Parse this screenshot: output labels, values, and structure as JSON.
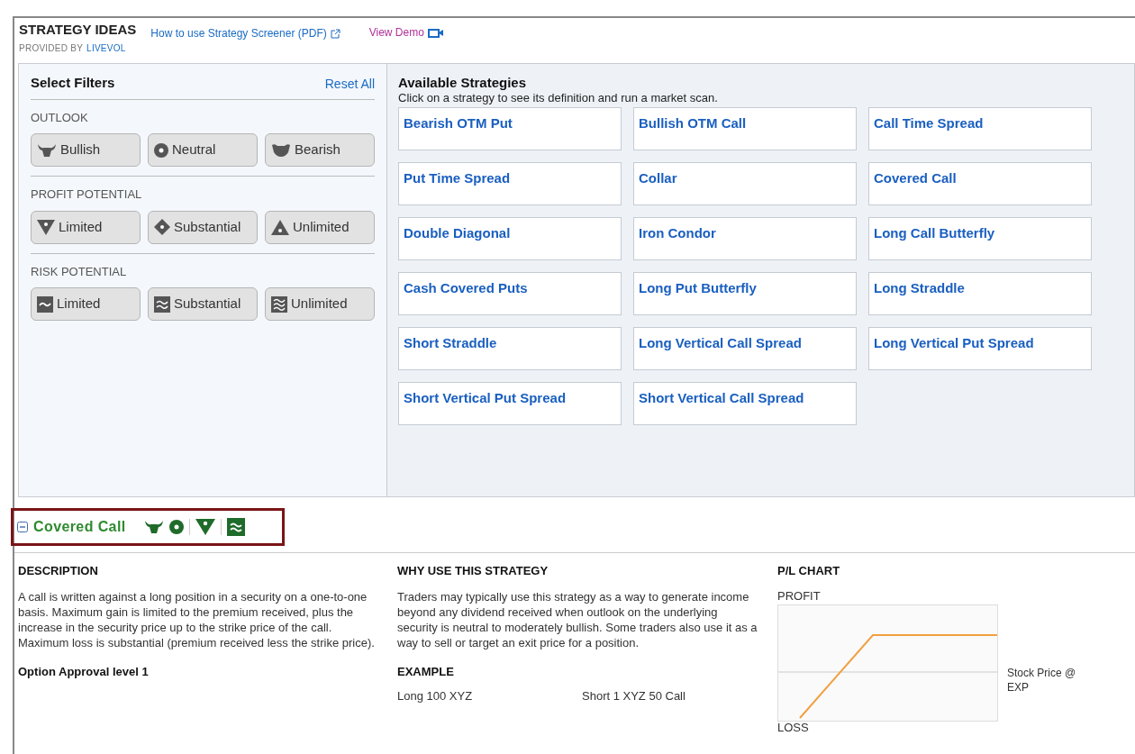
{
  "header": {
    "title": "STRATEGY IDEAS",
    "guide_link": "How to use Strategy Screener (PDF)",
    "demo_link": "View Demo",
    "provided_by": "PROVIDED BY",
    "provider": "LIVEVOL"
  },
  "filters": {
    "title": "Select Filters",
    "reset": "Reset All",
    "groups": [
      {
        "label": "OUTLOOK",
        "buttons": [
          "Bullish",
          "Neutral",
          "Bearish"
        ]
      },
      {
        "label": "PROFIT POTENTIAL",
        "buttons": [
          "Limited",
          "Substantial",
          "Unlimited"
        ]
      },
      {
        "label": "RISK POTENTIAL",
        "buttons": [
          "Limited",
          "Substantial",
          "Unlimited"
        ]
      }
    ]
  },
  "strategies": {
    "title": "Available Strategies",
    "subtitle": "Click on a strategy to see its definition and run a market scan.",
    "items": [
      "Bearish OTM Put",
      "Bullish OTM Call",
      "Call Time Spread",
      "Put Time Spread",
      "Collar",
      "Covered Call",
      "Double Diagonal",
      "Iron Condor",
      "Long Call Butterfly",
      "Cash Covered Puts",
      "Long Put Butterfly",
      "Long Straddle",
      "Short Straddle",
      "Long Vertical Call Spread",
      "Long Vertical Put Spread",
      "Short Vertical Put Spread",
      "Short Vertical Call Spread"
    ]
  },
  "detail": {
    "title": "Covered Call",
    "expanded": true,
    "description_heading": "DESCRIPTION",
    "description": "A call is written against a long position in a security on a one-to-one basis. Maximum gain is limited to the premium received, plus the increase in the security price up to the strike price of the call. Maximum loss is substantial (premium received less the strike price).",
    "approval": "Option Approval level 1",
    "why_heading": "WHY USE THIS STRATEGY",
    "why": "Traders may typically use this strategy as a way to generate income beyond any dividend received when outlook on the underlying security is neutral to moderately bullish. Some traders also use it as a way to sell or target an exit price for a position.",
    "example_heading": "EXAMPLE",
    "example": [
      "Long 100 XYZ",
      "Short 1 XYZ 50 Call"
    ],
    "chart_heading": "P/L CHART",
    "chart_profit": "PROFIT",
    "chart_loss": "LOSS",
    "chart_axis": "Stock Price @ EXP"
  }
}
